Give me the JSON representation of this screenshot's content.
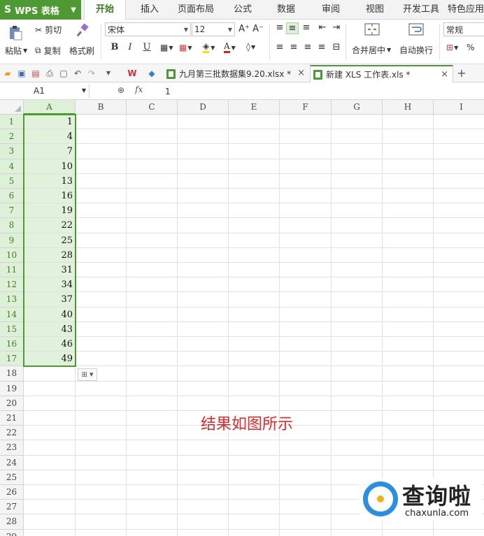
{
  "app": {
    "name": "WPS 表格",
    "logo_glyph": "S"
  },
  "menu_tabs": [
    "开始",
    "插入",
    "页面布局",
    "公式",
    "数据",
    "审阅",
    "视图",
    "开发工具",
    "特色应用"
  ],
  "active_menu_tab": "开始",
  "ribbon": {
    "paste": "粘贴",
    "cut": "剪切",
    "copy": "复制",
    "format_painter": "格式刷",
    "font_name": "宋体",
    "font_size": "12",
    "bold": "B",
    "italic": "I",
    "underline": "U",
    "grow_font": "A⁺",
    "shrink_font": "A⁻",
    "font_color_glyph": "A",
    "merge_center": "合并居中",
    "wrap_text": "自动换行",
    "number_format": "常规",
    "percent": "%"
  },
  "doc_tabs": [
    {
      "label": "九月第三批数据集9.20.xlsx *",
      "active": false
    },
    {
      "label": "新建 XLS 工作表.xls *",
      "active": true
    }
  ],
  "formula_bar": {
    "name_box": "A1",
    "fx": "fx",
    "value": "1"
  },
  "columns": [
    "A",
    "B",
    "C",
    "D",
    "E",
    "F",
    "G",
    "H",
    "I"
  ],
  "rows": [
    {
      "n": "1",
      "a": "1"
    },
    {
      "n": "2",
      "a": "4"
    },
    {
      "n": "3",
      "a": "7"
    },
    {
      "n": "4",
      "a": "10"
    },
    {
      "n": "5",
      "a": "13"
    },
    {
      "n": "6",
      "a": "16"
    },
    {
      "n": "7",
      "a": "19"
    },
    {
      "n": "8",
      "a": "22"
    },
    {
      "n": "9",
      "a": "25"
    },
    {
      "n": "10",
      "a": "28"
    },
    {
      "n": "11",
      "a": "31"
    },
    {
      "n": "12",
      "a": "34"
    },
    {
      "n": "13",
      "a": "37"
    },
    {
      "n": "14",
      "a": "40"
    },
    {
      "n": "15",
      "a": "43"
    },
    {
      "n": "16",
      "a": "46"
    },
    {
      "n": "17",
      "a": "49"
    },
    {
      "n": "18",
      "a": ""
    },
    {
      "n": "19",
      "a": ""
    },
    {
      "n": "20",
      "a": ""
    },
    {
      "n": "21",
      "a": ""
    },
    {
      "n": "22",
      "a": ""
    },
    {
      "n": "23",
      "a": ""
    },
    {
      "n": "24",
      "a": ""
    },
    {
      "n": "25",
      "a": ""
    },
    {
      "n": "26",
      "a": ""
    },
    {
      "n": "27",
      "a": ""
    },
    {
      "n": "28",
      "a": ""
    },
    {
      "n": "29",
      "a": ""
    }
  ],
  "selected_rows": 17,
  "annotation": "结果如图所示",
  "watermark": {
    "title": "查询啦",
    "url": "chaxunla.com"
  },
  "colors": {
    "accent": "#4e9a32",
    "selection_fill": "#e2f1db",
    "annotation": "#e02a2a"
  }
}
